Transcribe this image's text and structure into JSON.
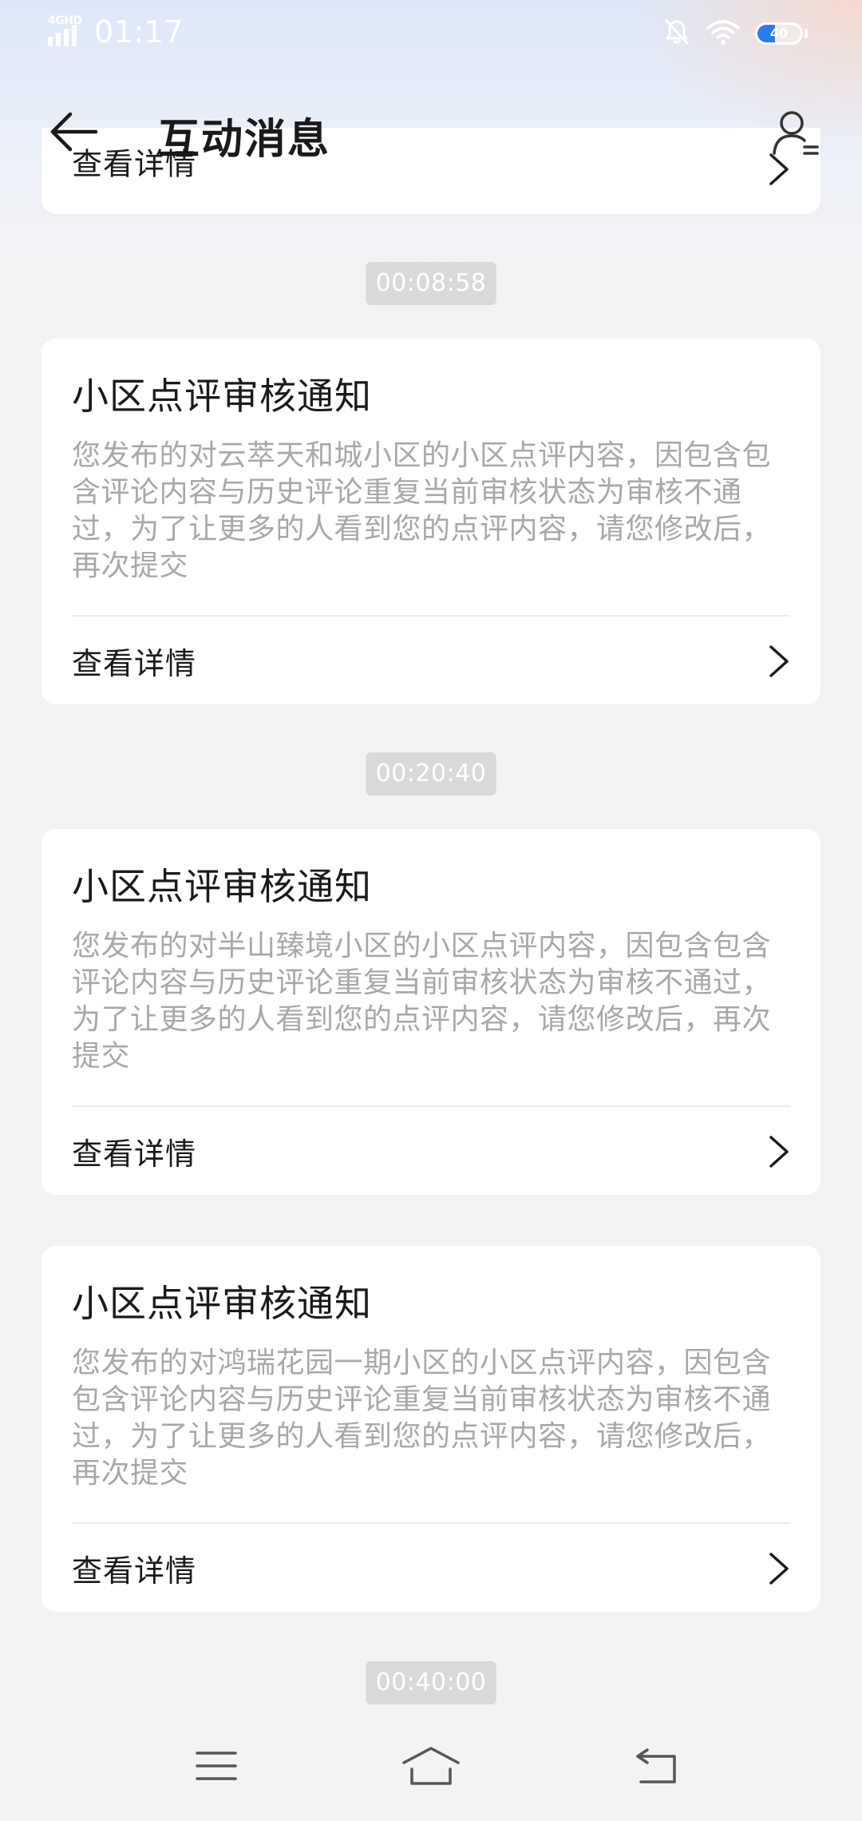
{
  "status_bar": {
    "network": "4GHD",
    "time": "01:17",
    "battery_level": "40",
    "battery_fraction": 0.4,
    "icons": [
      "signal-icon",
      "mute-bell-icon",
      "wifi-icon",
      "battery-icon"
    ]
  },
  "header": {
    "title": "互动消息",
    "back_icon": "arrow-left-icon",
    "profile_icon": "user-list-icon"
  },
  "messages": {
    "partial_card": {
      "action_label": "查看详情"
    },
    "timestamps": [
      "00:08:58",
      "00:20:40",
      "00:40:00"
    ],
    "cards": [
      {
        "title": "小区点评审核通知",
        "body": "您发布的对云萃天和城小区的小区点评内容，因包含包含评论内容与历史评论重复当前审核状态为审核不通过，为了让更多的人看到您的点评内容，请您修改后，再次提交",
        "action_label": "查看详情"
      },
      {
        "title": "小区点评审核通知",
        "body": "您发布的对半山臻境小区的小区点评内容，因包含包含评论内容与历史评论重复当前审核状态为审核不通过，为了让更多的人看到您的点评内容，请您修改后，再次提交",
        "action_label": "查看详情"
      },
      {
        "title": "小区点评审核通知",
        "body": "您发布的对鸿瑞花园一期小区的小区点评内容，因包含包含评论内容与历史评论重复当前审核状态为审核不通过，为了让更多的人看到您的点评内容，请您修改后，再次提交",
        "action_label": "查看详情"
      }
    ]
  },
  "nav_bar": {
    "buttons": [
      "menu-icon",
      "home-icon",
      "back-icon"
    ]
  },
  "colors": {
    "accent_battery": "#2c7cf0",
    "card_background": "#ffffff",
    "page_background": "#f3f3f4",
    "body_text": "#a8a8a8",
    "timestamp_chip": "#d9d9da"
  }
}
